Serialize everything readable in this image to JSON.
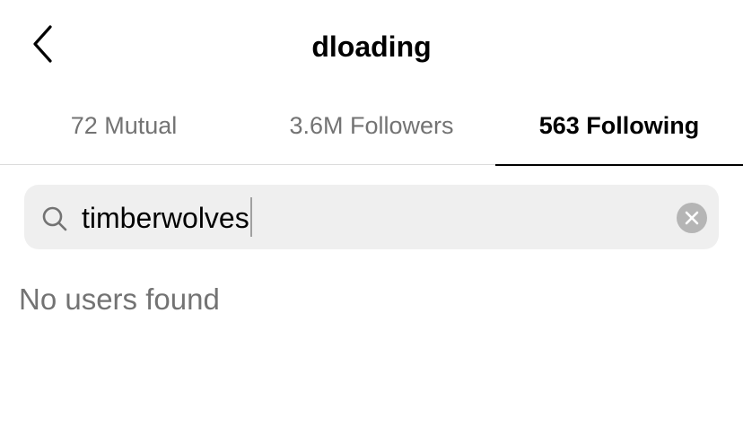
{
  "header": {
    "title": "dloading",
    "back_icon": "chevron-left-icon"
  },
  "tabs": [
    {
      "label": "72 Mutual",
      "active": false
    },
    {
      "label": "3.6M Followers",
      "active": false
    },
    {
      "label": "563 Following",
      "active": true
    }
  ],
  "search": {
    "value": "timberwolves",
    "icon": "search-icon",
    "clear_icon": "clear-icon"
  },
  "results": {
    "empty_message": "No users found"
  },
  "colors": {
    "background": "#ffffff",
    "text_primary": "#000000",
    "text_secondary": "#737373",
    "search_bg": "#efefef",
    "divider": "#dbdbdb",
    "clear_bg": "#b5b5b5"
  }
}
